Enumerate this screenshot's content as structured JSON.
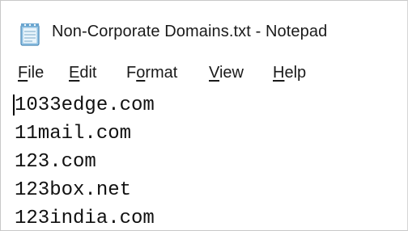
{
  "window": {
    "title": "Non-Corporate Domains.txt - Notepad",
    "icon": "notepad-icon"
  },
  "menu": {
    "items": [
      {
        "label": "File",
        "mnemonic": "F",
        "rest": "ile"
      },
      {
        "label": "Edit",
        "mnemonic": "E",
        "rest": "dit"
      },
      {
        "label": "Format",
        "pre": "F",
        "mnemonic": "o",
        "rest": "rmat"
      },
      {
        "label": "View",
        "mnemonic": "V",
        "rest": "iew"
      },
      {
        "label": "Help",
        "mnemonic": "H",
        "rest": "elp"
      }
    ]
  },
  "editor": {
    "lines": [
      "1033edge.com",
      "11mail.com",
      "123.com",
      "123box.net",
      "123india.com"
    ]
  },
  "colors": {
    "text": "#1a1a1a",
    "background": "#ffffff",
    "border": "#c8c8c8"
  }
}
